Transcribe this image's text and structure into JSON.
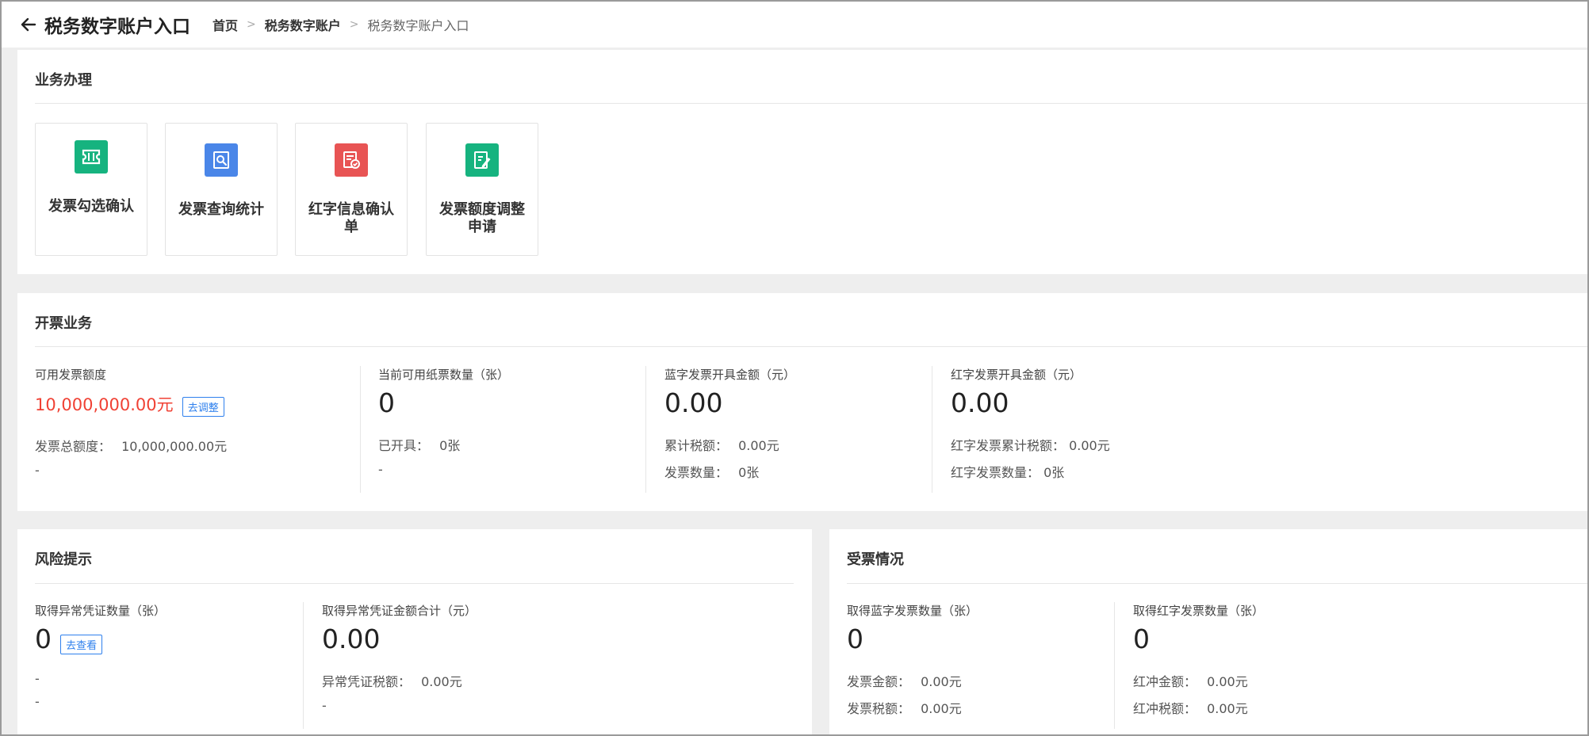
{
  "header": {
    "title": "税务数字账户入口",
    "breadcrumb": [
      "首页",
      "税务数字账户",
      "税务数字账户入口"
    ]
  },
  "business": {
    "title": "业务办理",
    "tiles": [
      {
        "label": "发票勾选确认",
        "icon": "ticket-icon",
        "color": "#16b37f"
      },
      {
        "label": "发票查询统计",
        "icon": "search-doc-icon",
        "color": "#4a86e8"
      },
      {
        "label": "红字信息确认单",
        "icon": "doc-check-icon",
        "color": "#e85454"
      },
      {
        "label": "发票额度调整申请",
        "icon": "edit-doc-icon",
        "color": "#16b37f"
      }
    ]
  },
  "invoicing": {
    "title": "开票业务",
    "quota": {
      "label": "可用发票额度",
      "value": "10,000,000.00元",
      "adjust_label": "去调整",
      "total_label": "发票总额度：",
      "total_value": "10,000,000.00元",
      "extra": "-"
    },
    "paper": {
      "label": "当前可用纸票数量（张）",
      "value": "0",
      "issued_label": "已开具：",
      "issued_value": "0张",
      "extra": "-"
    },
    "blue": {
      "label": "蓝字发票开具金额（元）",
      "value": "0.00",
      "tax_label": "累计税额：",
      "tax_value": "0.00元",
      "count_label": "发票数量：",
      "count_value": "0张"
    },
    "red": {
      "label": "红字发票开具金额（元）",
      "value": "0.00",
      "tax_label": "红字发票累计税额：",
      "tax_value": "0.00元",
      "count_label": "红字发票数量：",
      "count_value": "0张"
    }
  },
  "risk": {
    "title": "风险提示",
    "abnormal_count": {
      "label": "取得异常凭证数量（张）",
      "value": "0",
      "view_label": "去查看",
      "line1": "-",
      "line2": "-"
    },
    "abnormal_amount": {
      "label": "取得异常凭证金额合计（元）",
      "value": "0.00",
      "tax_label": "异常凭证税额：",
      "tax_value": "0.00元",
      "extra": "-"
    }
  },
  "receipt": {
    "title": "受票情况",
    "blue": {
      "label": "取得蓝字发票数量（张）",
      "value": "0",
      "amount_label": "发票金额：",
      "amount_value": "0.00元",
      "tax_label": "发票税额：",
      "tax_value": "0.00元"
    },
    "red": {
      "label": "取得红字发票数量（张）",
      "value": "0",
      "amount_label": "红冲金额：",
      "amount_value": "0.00元",
      "tax_label": "红冲税额：",
      "tax_value": "0.00元"
    }
  }
}
